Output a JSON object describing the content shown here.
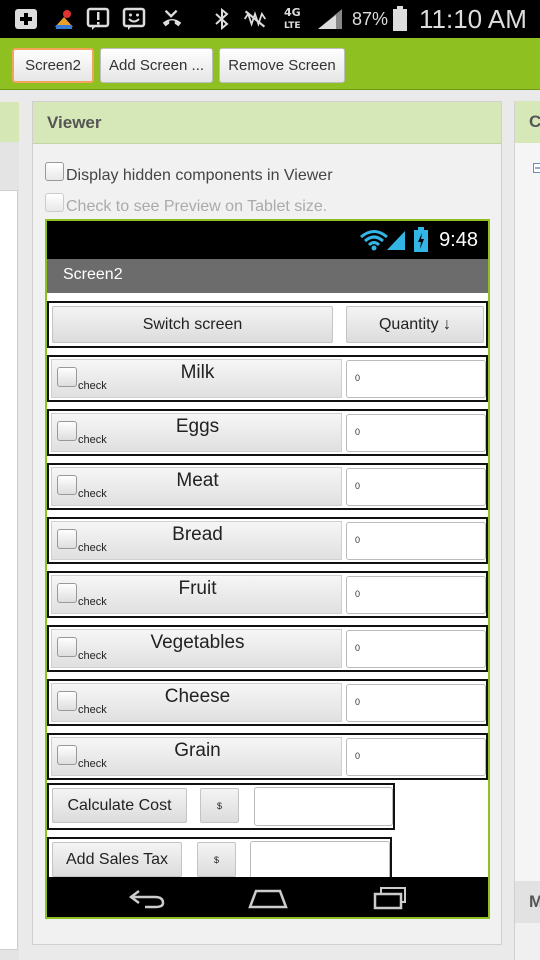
{
  "status_bar": {
    "battery_percent": "87%",
    "time": "11:10 AM",
    "network": "4G LTE",
    "icons": [
      "add-icon",
      "app-icon",
      "alert-icon",
      "smiley-icon",
      "missed-call-icon",
      "bluetooth-icon",
      "mute-icon",
      "network-4g-icon",
      "signal-icon",
      "battery-icon"
    ]
  },
  "toolbar": {
    "buttons": [
      "Screen2",
      "Add Screen ...",
      "Remove Screen"
    ]
  },
  "viewer": {
    "title": "Viewer",
    "option_hidden": "Display hidden components in Viewer",
    "option_tablet": "Check to see Preview on Tablet size."
  },
  "right_panel": {
    "header_letter": "C",
    "lower_letter": "M"
  },
  "phone": {
    "time": "9:48",
    "screen_title": "Screen2",
    "switch_label": "Switch screen",
    "quantity_label": "Quantity ↓",
    "items": [
      {
        "check": "check",
        "name": "Milk",
        "value": "0"
      },
      {
        "check": "check",
        "name": "Eggs",
        "value": "0"
      },
      {
        "check": "check",
        "name": "Meat",
        "value": "0"
      },
      {
        "check": "check",
        "name": "Bread",
        "value": "0"
      },
      {
        "check": "check",
        "name": "Fruit",
        "value": "0"
      },
      {
        "check": "check",
        "name": "Vegetables",
        "value": "0"
      },
      {
        "check": "check",
        "name": "Cheese",
        "value": "0"
      },
      {
        "check": "check",
        "name": "Grain",
        "value": "0"
      }
    ],
    "calculate_label": "Calculate Cost",
    "sales_tax_label": "Add Sales Tax",
    "currency": "$"
  },
  "colors": {
    "accent_green": "#8dc020",
    "header_green": "#d7e8b8",
    "active_border": "#f1a45a"
  }
}
